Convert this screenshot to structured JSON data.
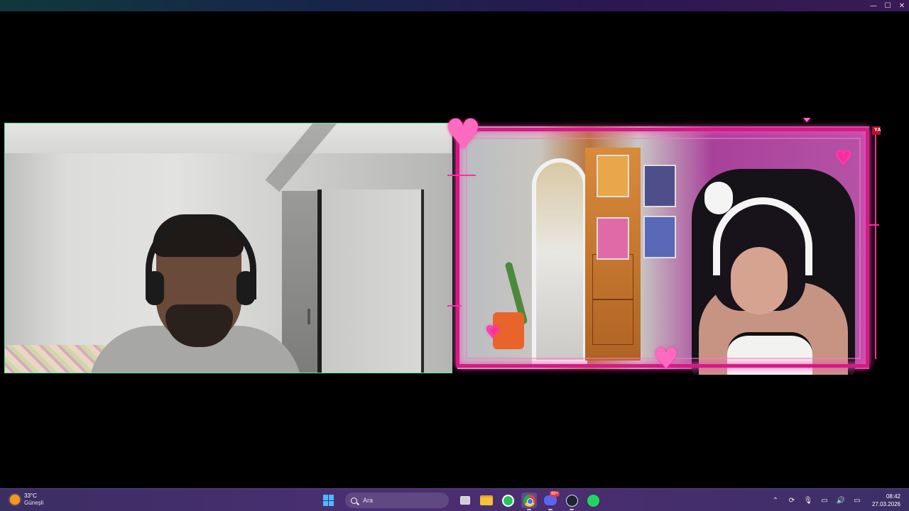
{
  "window": {
    "controls": {
      "minimize": "—",
      "maximize": "☐",
      "close": "✕"
    }
  },
  "stream": {
    "live_badge": "YAYINDA"
  },
  "taskbar": {
    "weather": {
      "temp": "33°C",
      "desc": "Güneşli",
      "icon": "sun-icon"
    },
    "search_placeholder": "Ara",
    "apps": [
      {
        "name": "start-button",
        "icon": "windows-icon"
      },
      {
        "name": "task-view",
        "icon": "task-view-icon"
      },
      {
        "name": "file-explorer",
        "icon": "folder-icon"
      },
      {
        "name": "whatsapp",
        "icon": "whatsapp-icon"
      },
      {
        "name": "chrome",
        "icon": "chrome-icon",
        "active": true
      },
      {
        "name": "discord",
        "icon": "discord-icon",
        "badge": "99+"
      },
      {
        "name": "steam",
        "icon": "steam-icon"
      },
      {
        "name": "spotify",
        "icon": "spotify-icon"
      }
    ],
    "tray": {
      "chevron": "⌃",
      "sync": "⟳",
      "mic": "🎙",
      "network": "▭",
      "volume": "🔊",
      "battery": "▭"
    },
    "clock": {
      "time": "08:42",
      "date": "27.03.2026"
    }
  },
  "colors": {
    "left_cam_border": "#5be4a2",
    "stream_frame": "#d21c84",
    "taskbar": "#4a2f72"
  }
}
